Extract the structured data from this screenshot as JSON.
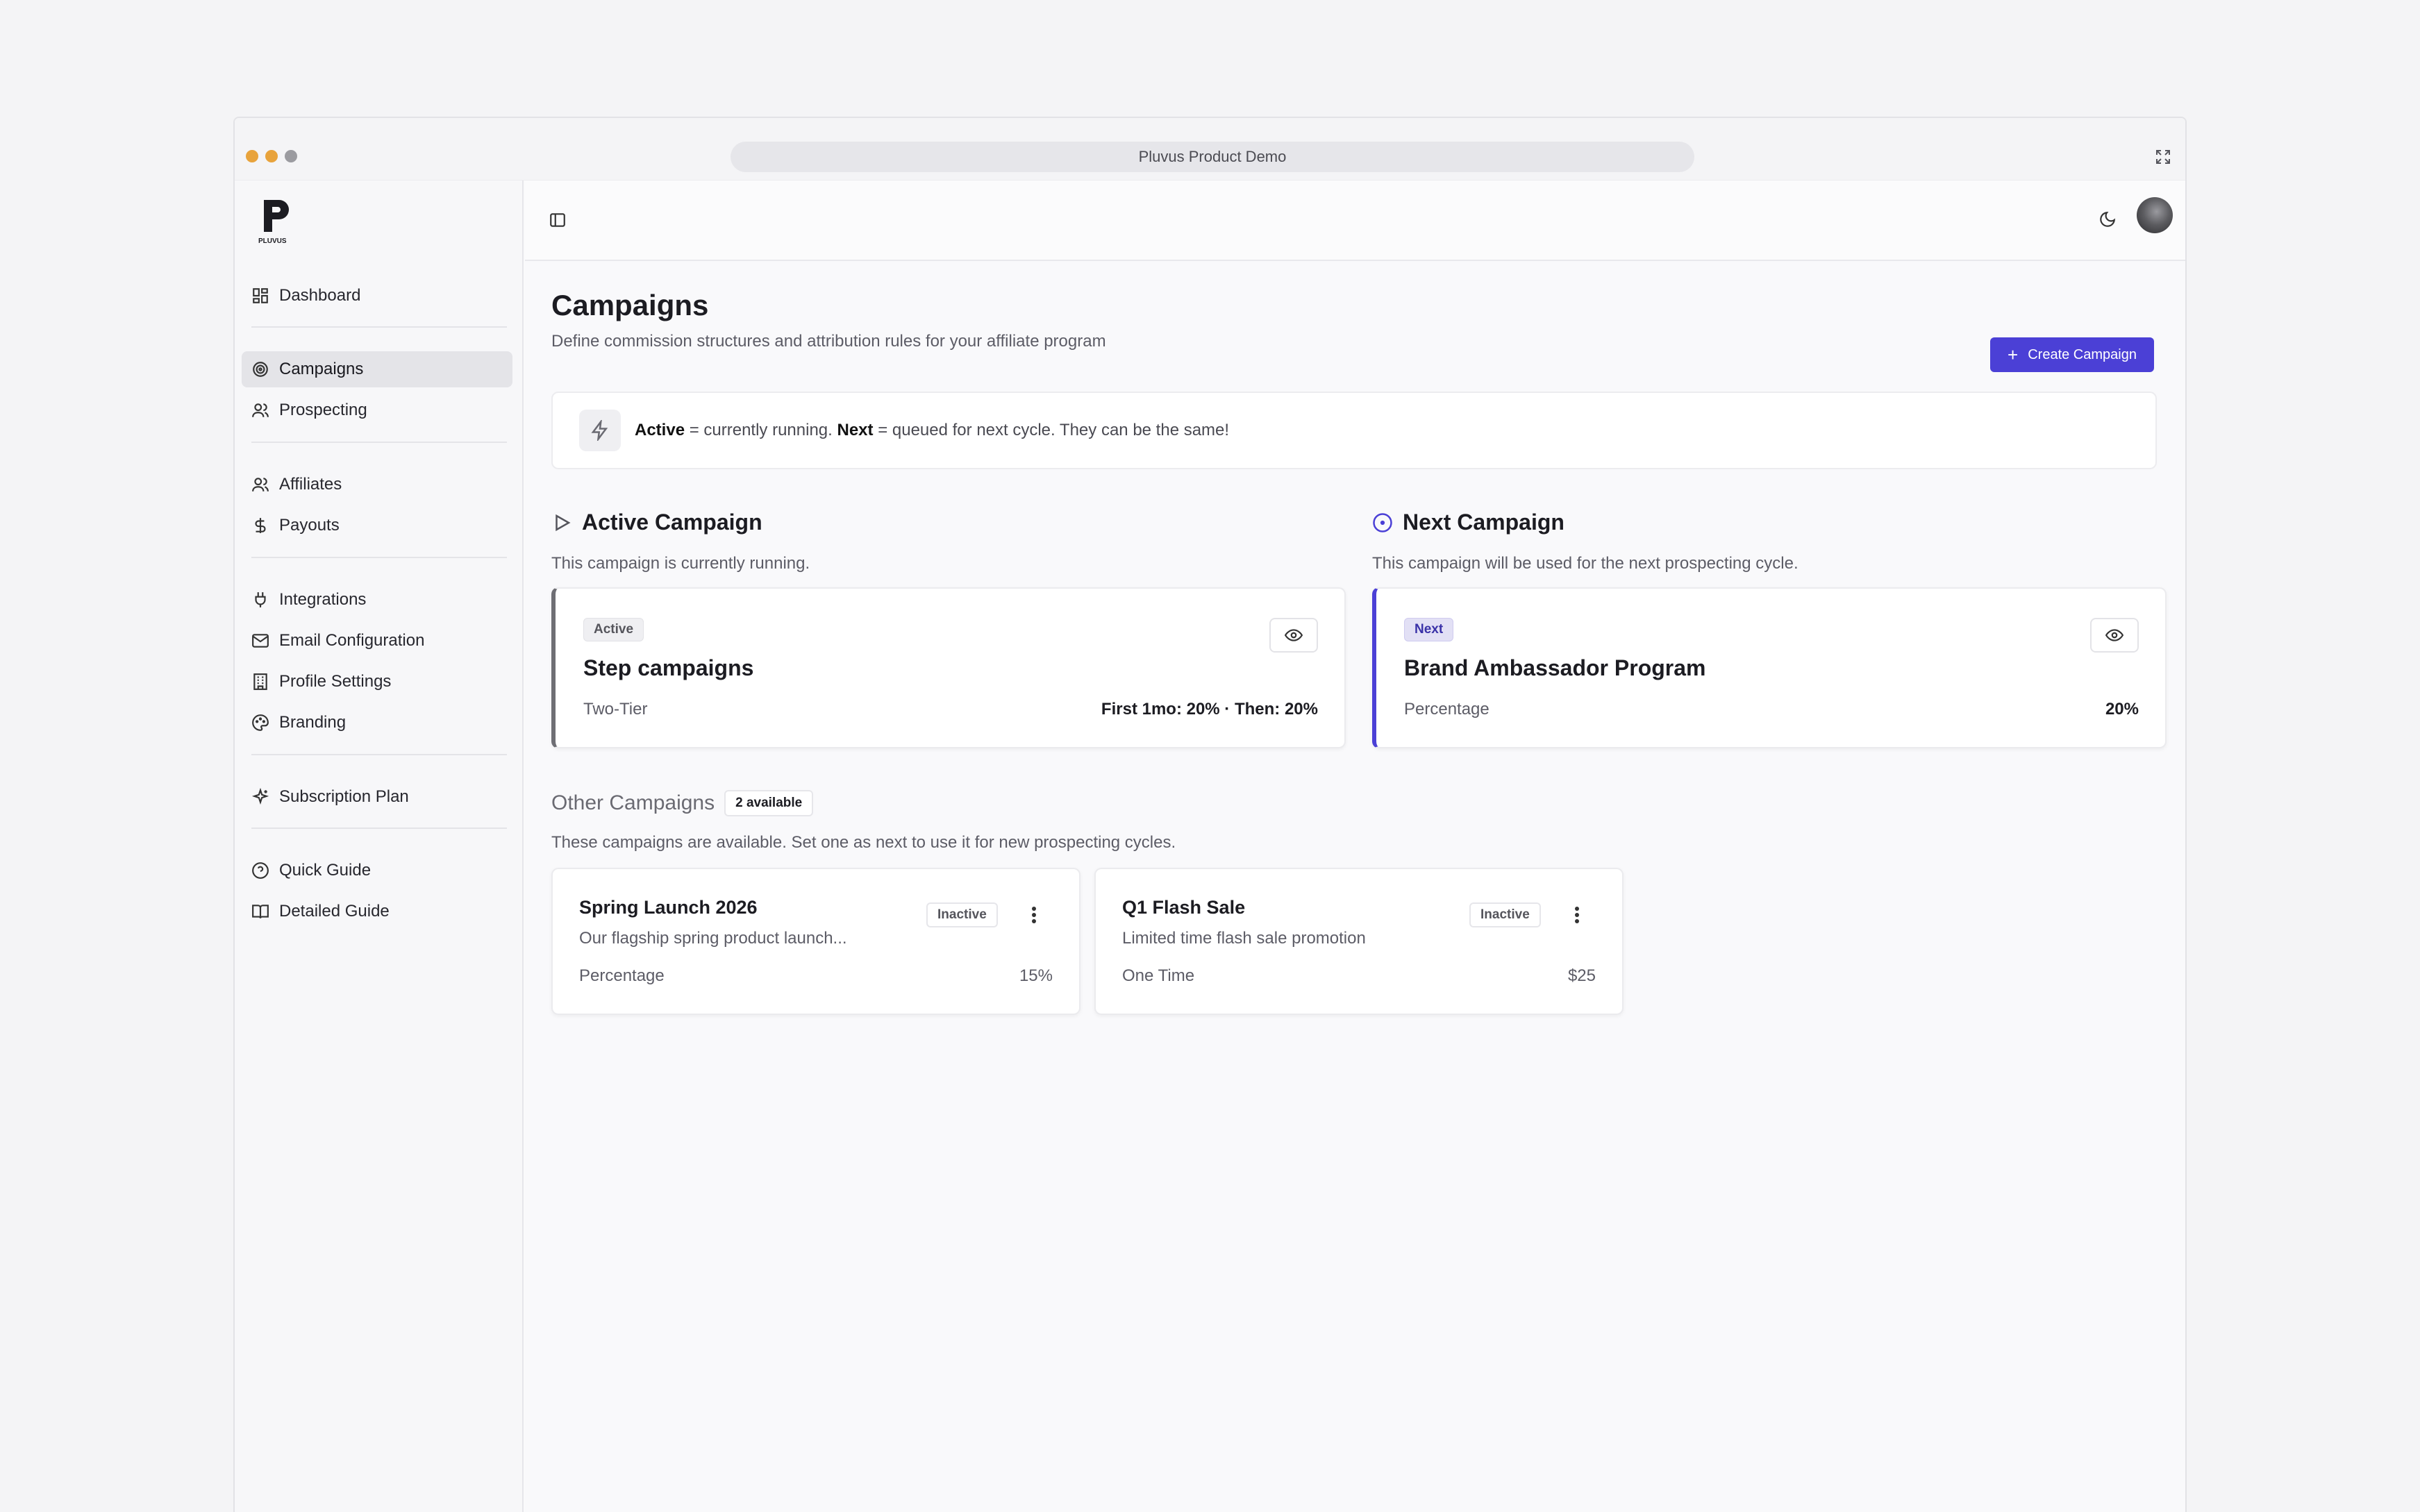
{
  "window": {
    "title": "Pluvus Product Demo",
    "dot_colors": [
      "#e8a33c",
      "#e8a33c",
      "#9b9ba0"
    ]
  },
  "brand": {
    "name": "PLUVUS"
  },
  "sidebar": {
    "items": [
      {
        "label": "Dashboard",
        "icon": "grid-icon"
      },
      {
        "label": "Campaigns",
        "icon": "target-icon",
        "active": true
      },
      {
        "label": "Prospecting",
        "icon": "users-icon"
      },
      {
        "label": "Affiliates",
        "icon": "users-icon"
      },
      {
        "label": "Payouts",
        "icon": "dollar-icon"
      },
      {
        "label": "Integrations",
        "icon": "plug-icon"
      },
      {
        "label": "Email Configuration",
        "icon": "mail-icon"
      },
      {
        "label": "Profile Settings",
        "icon": "building-icon"
      },
      {
        "label": "Branding",
        "icon": "palette-icon"
      },
      {
        "label": "Subscription Plan",
        "icon": "sparkle-icon"
      },
      {
        "label": "Quick Guide",
        "icon": "help-circle-icon"
      },
      {
        "label": "Detailed Guide",
        "icon": "book-icon"
      }
    ]
  },
  "page": {
    "title": "Campaigns",
    "subtitle": "Define commission structures and attribution rules for your affiliate program",
    "create_label": "Create Campaign",
    "accent": "#4b40d6"
  },
  "info": {
    "active_word": "Active",
    "active_text": " = currently running. ",
    "next_word": "Next",
    "next_text": " = queued for next cycle. They can be the same!"
  },
  "active_section": {
    "title": "Active Campaign",
    "desc": "This campaign is currently running.",
    "card": {
      "badge": "Active",
      "name": "Step campaigns",
      "type": "Two-Tier",
      "value": "First 1mo: 20% · Then: 20%"
    }
  },
  "next_section": {
    "title": "Next Campaign",
    "desc": "This campaign will be used for the next prospecting cycle.",
    "card": {
      "badge": "Next",
      "name": "Brand Ambassador Program",
      "type": "Percentage",
      "value": "20%"
    }
  },
  "other_section": {
    "title": "Other Campaigns",
    "count_badge": "2 available",
    "desc": "These campaigns are available. Set one as next to use it for new prospecting cycles.",
    "cards": [
      {
        "name": "Spring Launch 2026",
        "status": "Inactive",
        "desc": "Our flagship spring product launch...",
        "type": "Percentage",
        "value": "15%"
      },
      {
        "name": "Q1 Flash Sale",
        "status": "Inactive",
        "desc": "Limited time flash sale promotion",
        "type": "One Time",
        "value": "$25"
      }
    ]
  }
}
